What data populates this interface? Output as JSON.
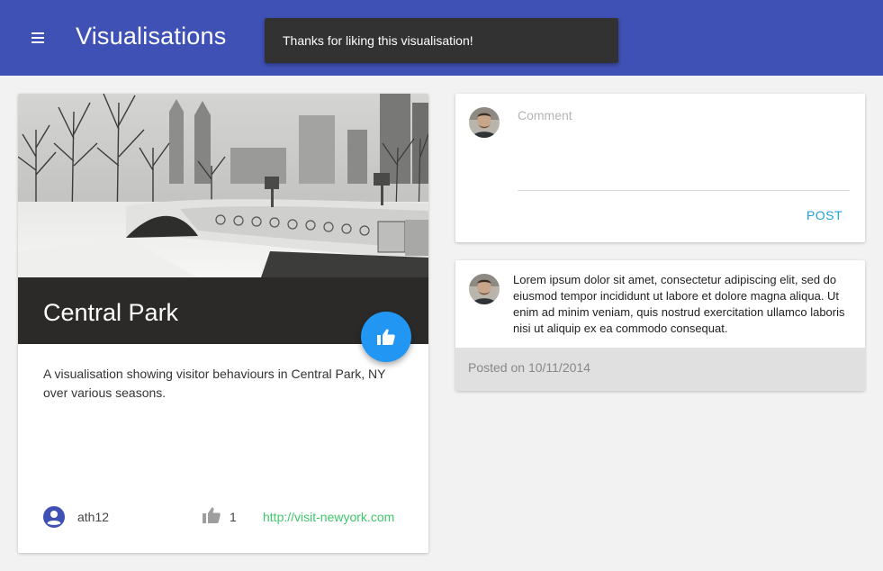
{
  "appbar": {
    "title": "Visualisations",
    "menu_icon": "menu-icon",
    "color": "#3f51b5"
  },
  "snackbar": {
    "message": "Thanks for liking this visualisation!"
  },
  "visualisation": {
    "title": "Central Park",
    "image": "central-park-winter-bridge-photo",
    "description": "A visualisation showing visitor behaviours in Central Park, NY over various seasons.",
    "author": "ath12",
    "likes": "1",
    "link": "http://visit-newyork.com",
    "like_button_icon": "thumb-up-icon",
    "fab_color": "#2196f3"
  },
  "comment_form": {
    "placeholder": "Comment",
    "post_label": "POST"
  },
  "comments": [
    {
      "text": "Lorem ipsum dolor sit amet, consectetur adipiscing elit, sed do eiusmod tempor incididunt ut labore et dolore magna aliqua. Ut enim ad minim veniam, quis nostrud exercitation ullamco laboris nisi ut aliquip ex ea commodo consequat.",
      "posted": "Posted on 10/11/2014"
    }
  ]
}
